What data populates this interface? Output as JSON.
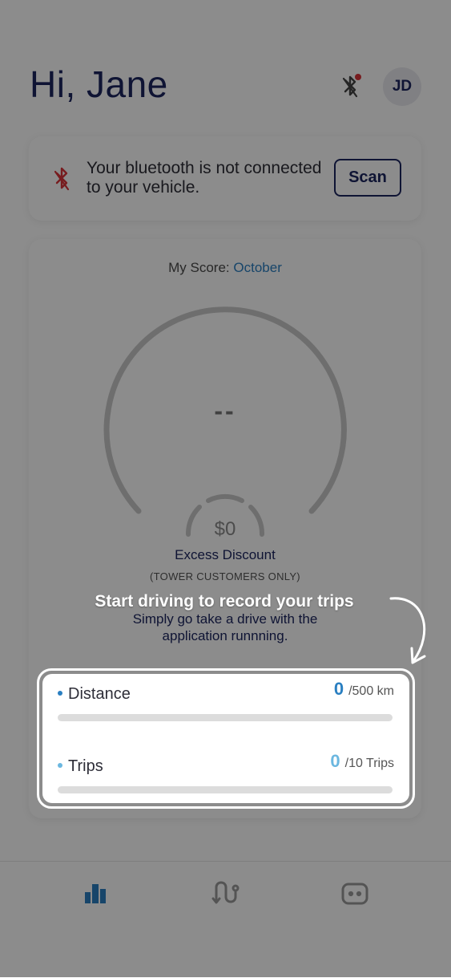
{
  "header": {
    "greeting": "Hi, Jane",
    "avatar_initials": "JD"
  },
  "bluetooth_card": {
    "message": "Your bluetooth is not connected to your vehicle.",
    "scan_label": "Scan"
  },
  "score_card": {
    "title_prefix": "My Score:",
    "month": "October",
    "score_value": "--",
    "discount_value": "$0",
    "excess_label": "Excess Discount",
    "tower_label": "(TOWER CUSTOMERS ONLY)",
    "hint_line1": "Simply go take a drive with the",
    "hint_line2": "application runnning."
  },
  "coachmark": {
    "title": "Start driving to record your trips"
  },
  "stats": [
    {
      "label": "Distance",
      "value": "0",
      "limit": "/500 km",
      "progress": 0,
      "color": "#2a7fc1"
    },
    {
      "label": "Trips",
      "value": "0",
      "limit": "/10 Trips",
      "progress": 0,
      "color": "#6bb7e0"
    }
  ],
  "nav": {
    "items": [
      "stats-icon",
      "route-icon",
      "chat-icon"
    ],
    "active_color": "#2a7fc1"
  },
  "colors": {
    "navy": "#1c2660",
    "accent": "#2a7fc1",
    "alert_red": "#d9343a"
  }
}
